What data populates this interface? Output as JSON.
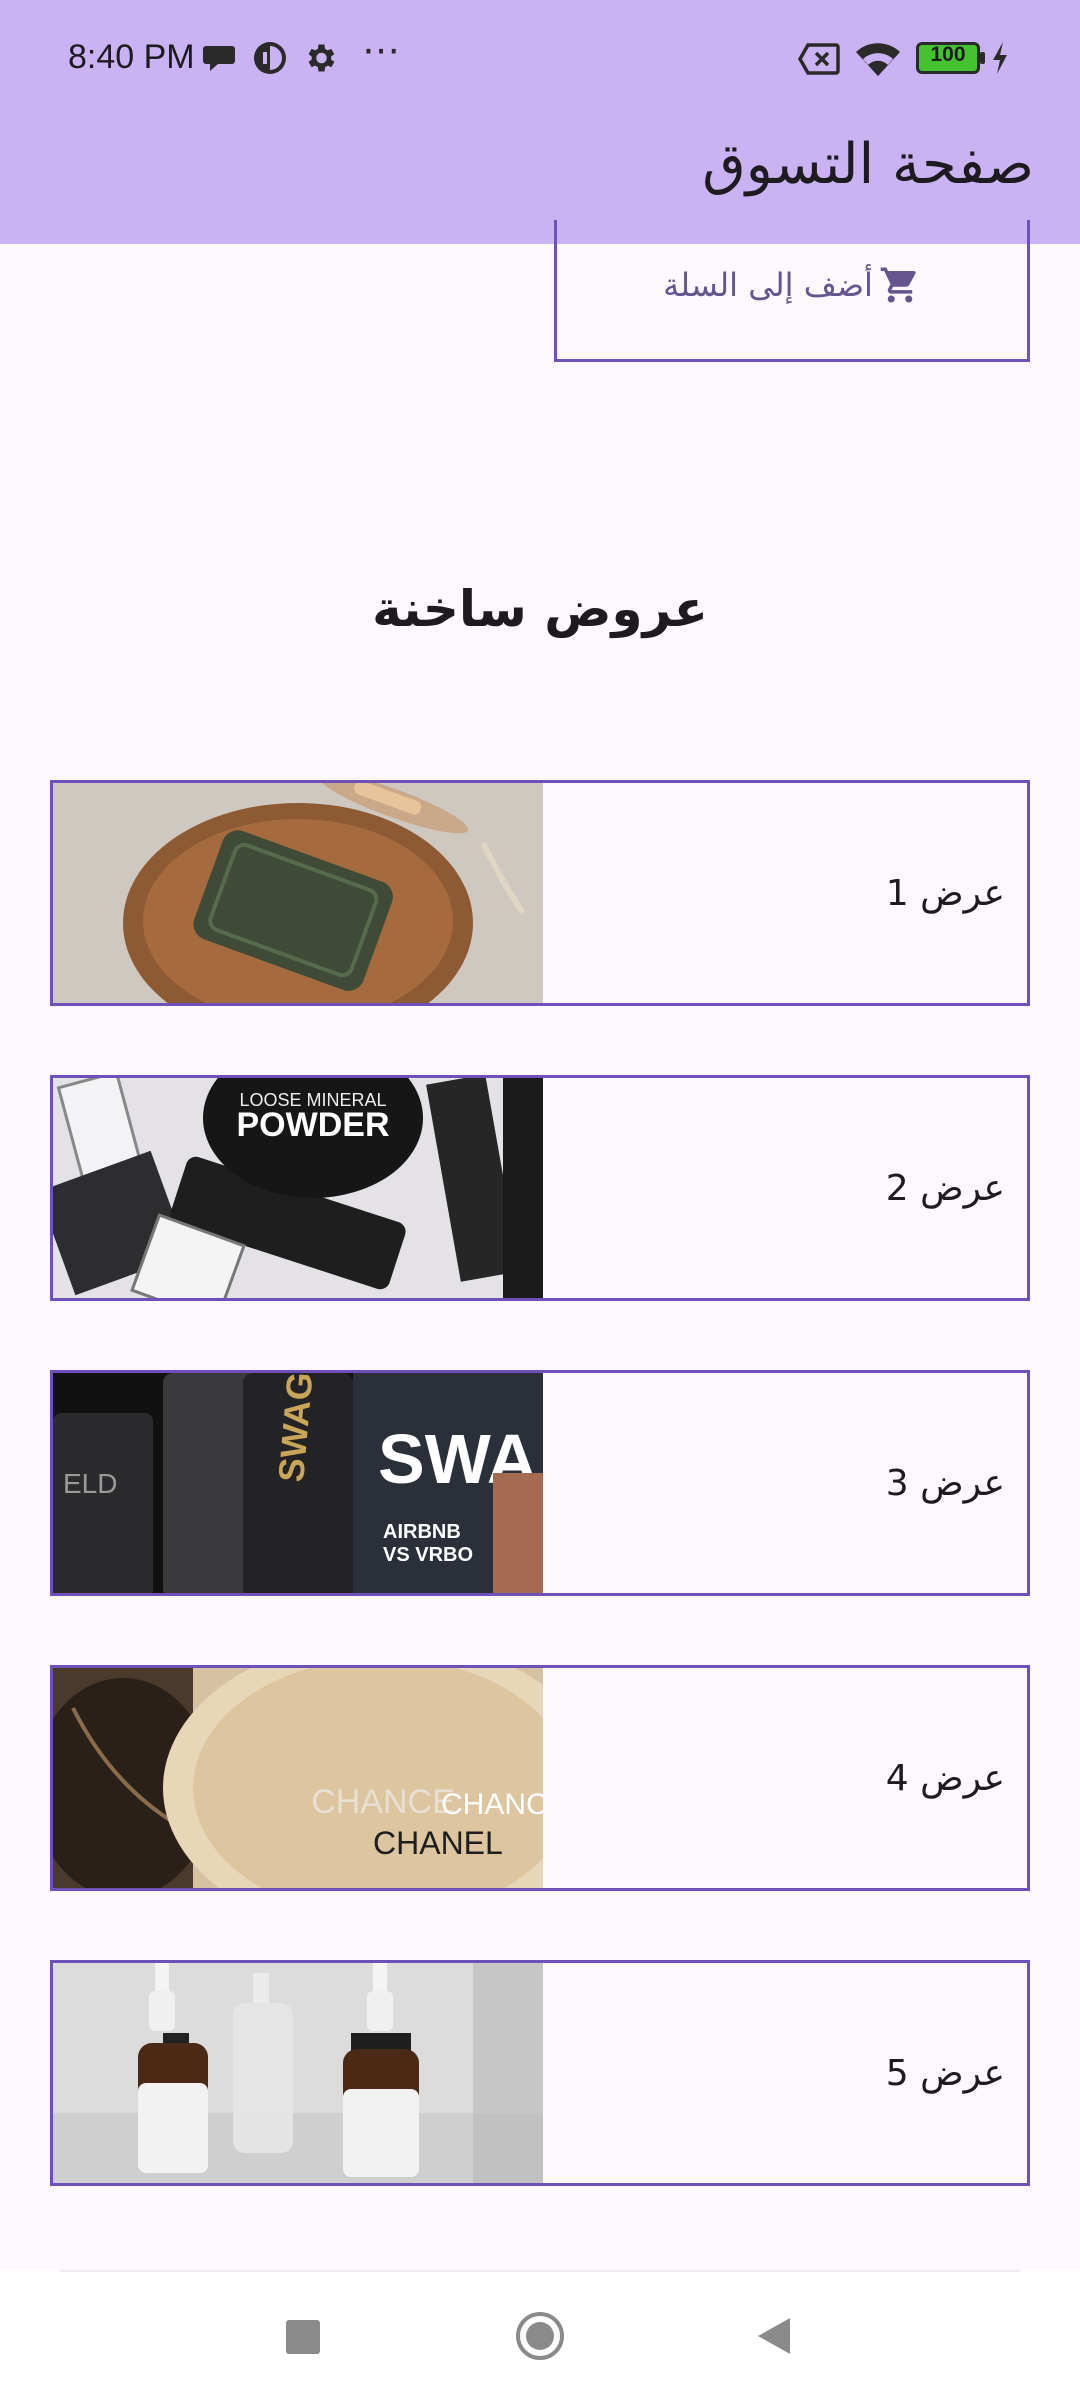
{
  "status_bar": {
    "time": "8:40 PM",
    "battery": "100"
  },
  "app_bar": {
    "title": "صفحة التسوق"
  },
  "cart_button": {
    "label": "أضف إلى السلة",
    "icon": "cart-icon"
  },
  "hot_offers": {
    "title": "عروض ساخنة",
    "items": [
      {
        "label": "عرض 1",
        "image": "green soap bar on wooden dish with brush"
      },
      {
        "label": "عرض 2",
        "image": "loose mineral powder and cosmetic bottles"
      },
      {
        "label": "عرض 3",
        "image": "black grooming products and magazine"
      },
      {
        "label": "عرض 4",
        "image": "Chanel Chance perfume bottle"
      },
      {
        "label": "عرض 5",
        "image": "amber dropper bottles"
      }
    ]
  },
  "colors": {
    "app_bar": "#C9B3F2",
    "background": "#FDF7FE",
    "accent": "#6F4FB8"
  }
}
